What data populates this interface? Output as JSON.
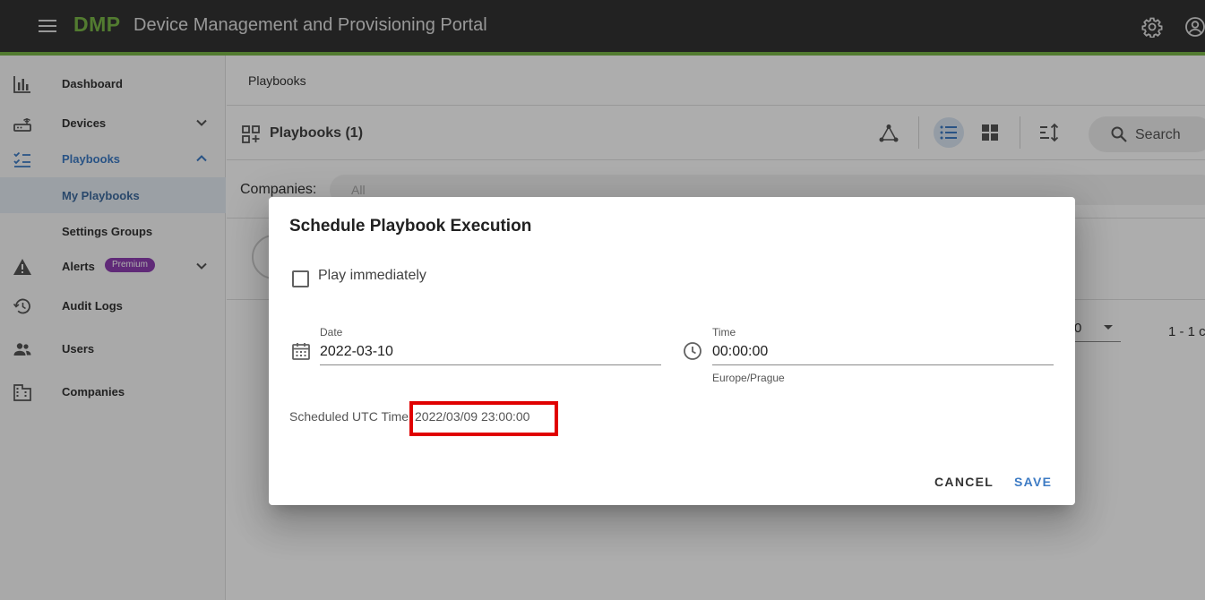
{
  "header": {
    "brand": "DMP",
    "title": "Device Management and Provisioning Portal"
  },
  "sidebar": {
    "items": [
      {
        "label": "Dashboard",
        "icon": "bar-chart-icon"
      },
      {
        "label": "Devices",
        "icon": "router-icon"
      },
      {
        "label": "Playbooks",
        "icon": "checklist-icon"
      },
      {
        "label": "My Playbooks"
      },
      {
        "label": "Settings Groups"
      },
      {
        "label": "Alerts",
        "icon": "warning-icon",
        "badge": "Premium"
      },
      {
        "label": "Audit Logs",
        "icon": "history-icon"
      },
      {
        "label": "Users",
        "icon": "people-icon"
      },
      {
        "label": "Companies",
        "icon": "building-icon"
      }
    ]
  },
  "main": {
    "breadcrumb": "Playbooks",
    "list_title": "Playbooks (1)",
    "search_label": "Search",
    "companies_label": "Companies:",
    "companies_value": "All",
    "page_size_partial": "0",
    "pagination_partial": "1 - 1 c"
  },
  "dialog": {
    "title": "Schedule Playbook Execution",
    "play_immediately_label": "Play immediately",
    "play_immediately_checked": false,
    "date_label": "Date",
    "date_value": "2022-03-10",
    "time_label": "Time",
    "time_value": "00:00:00",
    "timezone": "Europe/Prague",
    "utc_label": "Scheduled UTC Time:",
    "utc_value": "2022/03/09 23:00:00",
    "cancel_label": "CANCEL",
    "save_label": "SAVE"
  },
  "colors": {
    "brand_green": "#7ab648",
    "accent_blue": "#3d7bc4",
    "highlight_red": "#e00000",
    "premium_purple": "#8e3fb2"
  }
}
